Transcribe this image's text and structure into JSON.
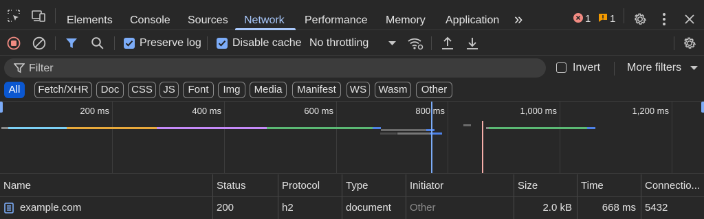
{
  "tabs": [
    "Elements",
    "Console",
    "Sources",
    "Network",
    "Performance",
    "Memory",
    "Application"
  ],
  "active_tab": "Network",
  "more_tabs_glyph": "»",
  "error_count": "1",
  "warning_count": "1",
  "toolbar": {
    "preserve_log_label": "Preserve log",
    "preserve_log_checked": true,
    "disable_cache_label": "Disable cache",
    "disable_cache_checked": true,
    "throttling_value": "No throttling"
  },
  "filter": {
    "placeholder": "Filter",
    "invert_label": "Invert",
    "invert_checked": false,
    "more_filters_label": "More filters"
  },
  "type_filters": [
    "All",
    "Fetch/XHR",
    "Doc",
    "CSS",
    "JS",
    "Font",
    "Img",
    "Media",
    "Manifest",
    "WS",
    "Wasm",
    "Other"
  ],
  "active_type_filter": "All",
  "timeline_ticks": [
    "200 ms",
    "400 ms",
    "600 ms",
    "800 ms",
    "1,000 ms",
    "1,200 ms"
  ],
  "columns": [
    "Name",
    "Status",
    "Protocol",
    "Type",
    "Initiator",
    "Size",
    "Time",
    "Connectio..."
  ],
  "rows": [
    {
      "name": "example.com",
      "status": "200",
      "protocol": "h2",
      "type": "document",
      "initiator": "Other",
      "size": "2.0 kB",
      "time": "668 ms",
      "connection": "5432"
    }
  ],
  "colors": {
    "accent": "#a8c7fa",
    "error": "#f28b82",
    "warning": "#f29900",
    "chip_active": "#0b57d0",
    "record": "#f28b82"
  }
}
